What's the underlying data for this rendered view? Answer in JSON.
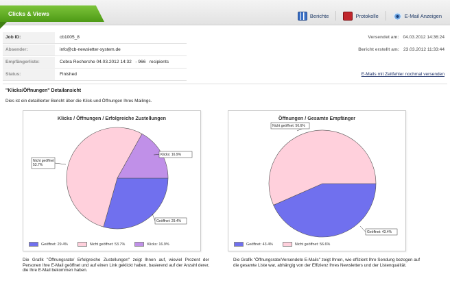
{
  "header": {
    "tab_title": "Clicks & Views",
    "buttons": [
      {
        "label": "Berichte",
        "icon": "chart-icon"
      },
      {
        "label": "Protokolle",
        "icon": "document-icon"
      },
      {
        "label": "E-Mail Anzeigen",
        "icon": "eye-icon"
      }
    ]
  },
  "job": {
    "job_id_label": "Job ID:",
    "job_id": "cb1005_8",
    "sender_label": "Absender:",
    "sender": "info@cb-newsletter-system.de",
    "recipients_label": "Empfängerliste:",
    "recipients": "Cobra Recherche 04.03.2012 14:32   - 966   recipients",
    "status_label": "Status:",
    "status": "Finished",
    "sent_label": "Versendet am:",
    "sent": "04.03.2012 14:36:24",
    "report_label": "Bericht erstellt am:",
    "report": "23.03.2012 11:33:44",
    "resend_link": "E-Mails mit Zeitfehler nochmal versenden"
  },
  "section": {
    "title": "\"Klicks/Öffnungen\" Detailansicht",
    "description": "Dies ist ein detaillierter Bericht über die Klick-und Öffnungen Ihres Mailings."
  },
  "chart_data": [
    {
      "type": "pie",
      "title": "Klicks / Öffnungen / Erfolgreiche Zustellungen",
      "categories": [
        "Geöffnet",
        "Nicht geöffnet",
        "Klicks"
      ],
      "values": [
        29.4,
        53.7,
        16.9
      ],
      "colors": [
        "#7070ee",
        "#ffd0dc",
        "#c090e8"
      ],
      "slice_labels": [
        "Geöffnet: 29.4%",
        "Nicht geöffnet: 53.7%",
        "Klicks: 16.9%"
      ],
      "legend": [
        "Geöffnet: 29.4%",
        "Nicht geöffnet: 53.7%",
        "Klicks: 16.9%"
      ],
      "legend_position": "bottom"
    },
    {
      "type": "pie",
      "title": "Öffnungen / Gesamte Empfänger",
      "categories": [
        "Geöffnet",
        "Nicht geöffnet"
      ],
      "values": [
        43.4,
        56.6
      ],
      "colors": [
        "#7070ee",
        "#ffd0dc"
      ],
      "slice_labels": [
        "Geöffnet: 43.4%",
        "Nicht geöffnet: 56.6%"
      ],
      "legend": [
        "Geöffnet: 43.4%",
        "Nicht geöffnet: 56.6%"
      ],
      "legend_position": "bottom"
    }
  ],
  "captions": {
    "left": "Die Grafik \"Öffnungsrate/ Erfolgreiche Zustellungen\" zeigt Ihnen auf, wieviel Prozent der Personen Ihre E-Mail geöffnet und auf einen Link geklickt haben, basierend auf der Anzahl derer, die Ihre E-Mail bekommen haben.",
    "right": "Die Grafik \"Öffnungsrate/Versendete E-Mails\" zeigt Ihnen, wie effizient Ihre Sendung bezogen auf die gesamte Liste war, abhängig von der Effizienz Ihres Newsletters und der Listenqualität."
  }
}
